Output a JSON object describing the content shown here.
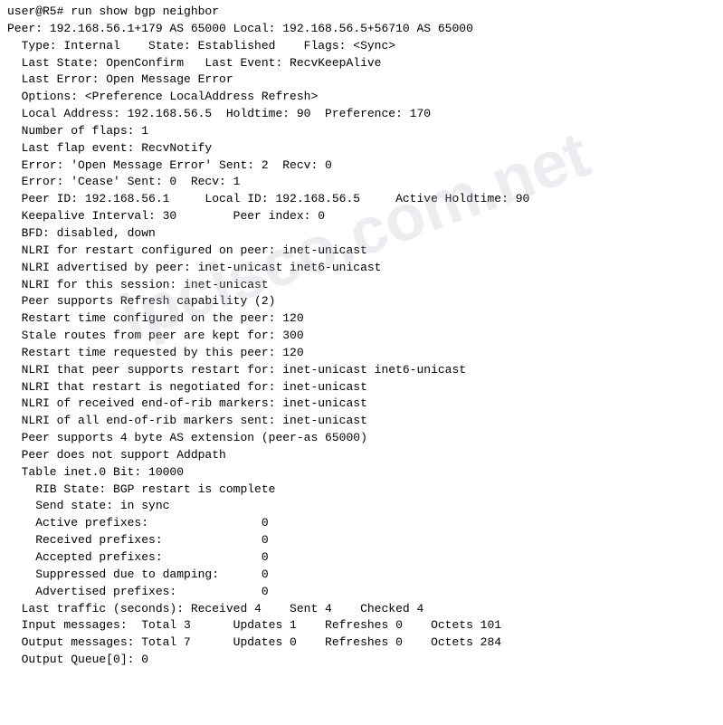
{
  "terminal": {
    "lines": [
      "user@R5# run show bgp neighbor",
      "Peer: 192.168.56.1+179 AS 65000 Local: 192.168.56.5+56710 AS 65000",
      "  Type: Internal    State: Established    Flags: <Sync>",
      "  Last State: OpenConfirm   Last Event: RecvKeepAlive",
      "  Last Error: Open Message Error",
      "  Options: <Preference LocalAddress Refresh>",
      "  Local Address: 192.168.56.5  Holdtime: 90  Preference: 170",
      "  Number of flaps: 1",
      "  Last flap event: RecvNotify",
      "  Error: 'Open Message Error' Sent: 2  Recv: 0",
      "  Error: 'Cease' Sent: 0  Recv: 1",
      "  Peer ID: 192.168.56.1     Local ID: 192.168.56.5     Active Holdtime: 90",
      "  Keepalive Interval: 30        Peer index: 0",
      "  BFD: disabled, down",
      "  NLRI for restart configured on peer: inet-unicast",
      "  NLRI advertised by peer: inet-unicast inet6-unicast",
      "  NLRI for this session: inet-unicast",
      "  Peer supports Refresh capability (2)",
      "  Restart time configured on the peer: 120",
      "  Stale routes from peer are kept for: 300",
      "  Restart time requested by this peer: 120",
      "  NLRI that peer supports restart for: inet-unicast inet6-unicast",
      "  NLRI that restart is negotiated for: inet-unicast",
      "  NLRI of received end-of-rib markers: inet-unicast",
      "  NLRI of all end-of-rib markers sent: inet-unicast",
      "  Peer supports 4 byte AS extension (peer-as 65000)",
      "  Peer does not support Addpath",
      "  Table inet.0 Bit: 10000",
      "    RIB State: BGP restart is complete",
      "    Send state: in sync",
      "    Active prefixes:                0",
      "    Received prefixes:              0",
      "    Accepted prefixes:              0",
      "    Suppressed due to damping:      0",
      "    Advertised prefixes:            0",
      "  Last traffic (seconds): Received 4    Sent 4    Checked 4",
      "  Input messages:  Total 3      Updates 1    Refreshes 0    Octets 101",
      "  Output messages: Total 7      Updates 0    Refreshes 0    Octets 284",
      "  Output Queue[0]: 0"
    ],
    "watermark": "ipcisco.com.net"
  }
}
